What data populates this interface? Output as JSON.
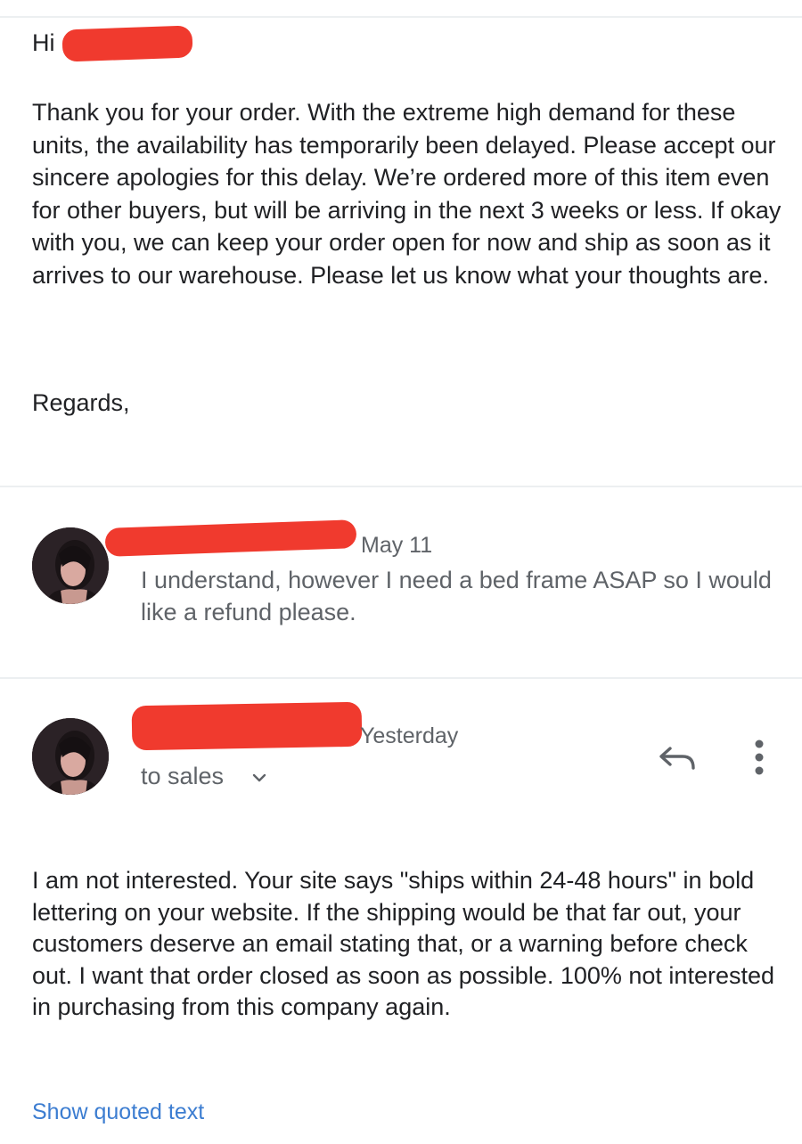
{
  "message1": {
    "greeting": "Hi",
    "body": "Thank you for your order. With the extreme high demand for these units, the availability has temporarily been delayed. Please accept our sincere apologies for this delay. We’re ordered more of this item even for other buyers, but will be arriving in the next 3 weeks or less. If okay with you, we can keep your order open for now and ship as soon as it arrives to our warehouse. Please let us know what your thoughts are.",
    "signoff": "Regards,"
  },
  "message2": {
    "date": "May 11",
    "snippet": "I understand, however I need a bed frame ASAP so I would like a refund please."
  },
  "message3": {
    "date": "Yesterday",
    "recipient": "to sales",
    "body": "I am not interested.  Your site says \"ships within 24-48 hours\" in bold lettering on your website. If the shipping would be that far out, your customers deserve an email stating that, or a warning before check out. I want that order closed as soon as possible. 100% not interested in purchasing from this company again.",
    "show_quoted_label": "Show quoted text",
    "reply_icon": "reply-icon",
    "more_icon": "more-vert-icon"
  },
  "colors": {
    "redaction": "#f03a2e",
    "link": "#3c7dd1",
    "secondary_text": "#5f6368"
  }
}
